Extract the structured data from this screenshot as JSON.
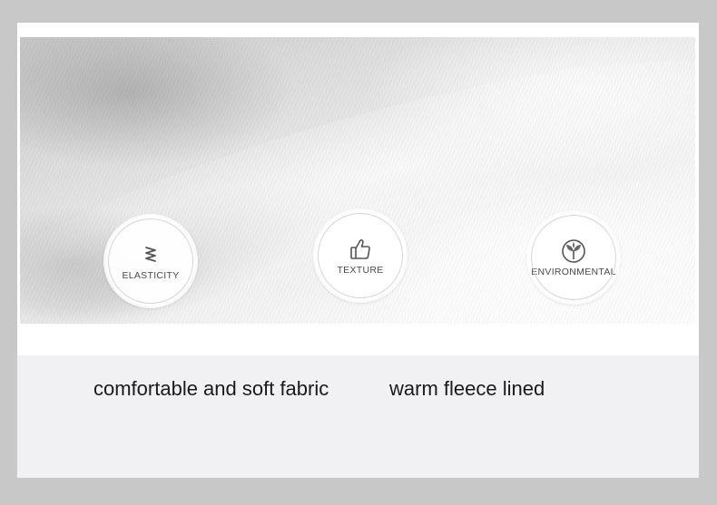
{
  "features": [
    {
      "label": "ELASTICITY",
      "icon": "spring-zigzag-icon"
    },
    {
      "label": "TEXTURE",
      "icon": "thumbs-up-icon"
    },
    {
      "label": "ENVIRONMENTAL",
      "icon": "leaf-sprout-icon"
    }
  ],
  "captions": {
    "left": "comfortable and soft fabric",
    "right": "warm fleece lined"
  },
  "colors": {
    "page_background": "#c8c8c8",
    "band_background": "#f1f1f3",
    "text": "#1a1a1a"
  }
}
